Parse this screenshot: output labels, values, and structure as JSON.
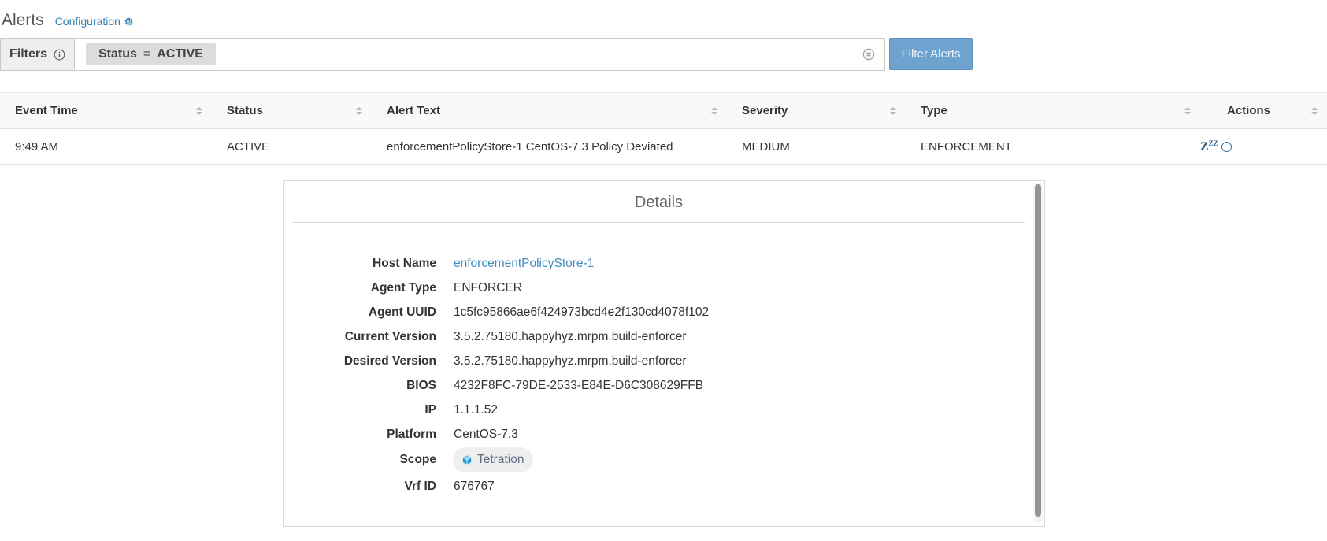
{
  "header": {
    "title": "Alerts",
    "config_link": "Configuration",
    "config_icon": "gear-icon"
  },
  "filters": {
    "label": "Filters",
    "info_icon": "info-icon",
    "chip": {
      "field": "Status",
      "operator": "=",
      "value": "ACTIVE"
    },
    "clear_icon": "clear-circle-x-icon",
    "button": "Filter Alerts"
  },
  "table": {
    "columns": [
      "Event Time",
      "Status",
      "Alert Text",
      "Severity",
      "Type",
      "Actions"
    ],
    "rows": [
      {
        "event_time": "9:49 AM",
        "status": "ACTIVE",
        "alert_text": "enforcementPolicyStore-1 CentOS-7.3 Policy Deviated",
        "severity": "MEDIUM",
        "type": "ENFORCEMENT",
        "actions": {
          "snooze": "Z",
          "snooze_sup": "ZZ",
          "snooze_icon": "snooze-icon",
          "circle_icon": "circle-icon"
        }
      }
    ]
  },
  "details": {
    "title": "Details",
    "fields": [
      {
        "label": "Host Name",
        "value": "enforcementPolicyStore-1"
      },
      {
        "label": "Agent Type",
        "value": "ENFORCER"
      },
      {
        "label": "Agent UUID",
        "value": "1c5fc95866ae6f424973bcd4e2f130cd4078f102"
      },
      {
        "label": "Current Version",
        "value": "3.5.2.75180.happyhyz.mrpm.build-enforcer"
      },
      {
        "label": "Desired Version",
        "value": "3.5.2.75180.happyhyz.mrpm.build-enforcer"
      },
      {
        "label": "BIOS",
        "value": "4232F8FC-79DE-2533-E84E-D6C308629FFB"
      },
      {
        "label": "IP",
        "value": "1.1.1.52"
      },
      {
        "label": "Platform",
        "value": "CentOS-7.3"
      },
      {
        "label": "Scope",
        "value": "Tetration",
        "icon": "cube-icon"
      },
      {
        "label": "Vrf ID",
        "value": "676767"
      }
    ]
  },
  "colors": {
    "link": "#2e7fb0",
    "button": "#6ea2cf",
    "scope_icon": "#2b9fd6",
    "action_icon": "#2b5f8e"
  }
}
